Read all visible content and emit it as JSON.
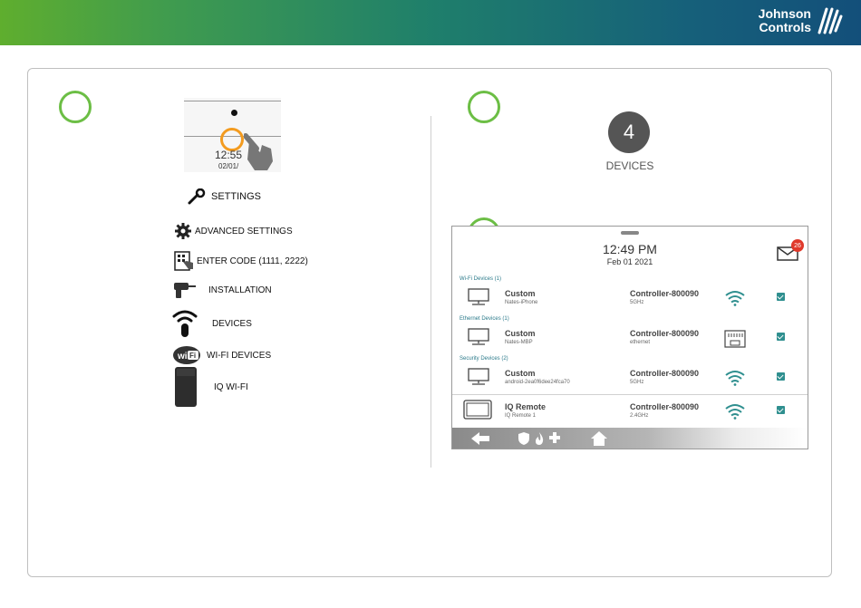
{
  "brand": {
    "line1": "Johnson",
    "line2": "Controls",
    "color": "#ffffff"
  },
  "colors": {
    "accent_green": "#6cbe45",
    "orange_ring": "#f39b1f",
    "teal": "#2f8f8f",
    "badge_red": "#e0392b"
  },
  "left": {
    "phone": {
      "time": "12:55",
      "date": "02/01/"
    },
    "settings_label": "SETTINGS",
    "menu": [
      {
        "icon": "gear-icon",
        "label": "ADVANCED SETTINGS"
      },
      {
        "icon": "keypad-hand-icon",
        "label": "ENTER CODE (1111, 2222)"
      },
      {
        "icon": "drill-icon",
        "label": "INSTALLATION"
      },
      {
        "icon": "remote-wifi-icon",
        "label": "DEVICES"
      },
      {
        "icon": "wifi-badge-icon",
        "label": "WI-FI DEVICES"
      },
      {
        "icon": "router-icon",
        "label": "IQ WI-FI"
      }
    ]
  },
  "right": {
    "devices_count": "4",
    "devices_label": "DEVICES",
    "tablet": {
      "time": "12:49 PM",
      "date": "Feb 01 2021",
      "mail_count": "26",
      "sections": [
        {
          "title": "Wi-Fi Devices (1)"
        },
        {
          "title": "Ethernet Devices (1)"
        },
        {
          "title": "Security Devices (2)"
        }
      ],
      "rows": [
        {
          "name": "Custom",
          "sub": "Nates-iPhone",
          "controller": "Controller-800090",
          "band": "5GHz",
          "icon": "wifi-signal-icon",
          "checked": true
        },
        {
          "name": "Custom",
          "sub": "Nates-MBP",
          "controller": "Controller-800090",
          "band": "ethernet",
          "icon": "ethernet-port-icon",
          "checked": true
        },
        {
          "name": "Custom",
          "sub": "android-2ea0f6dee24fca70",
          "controller": "Controller-800090",
          "band": "5GHz",
          "icon": "wifi-signal-icon",
          "checked": true
        },
        {
          "name": "IQ Remote",
          "sub": "IQ Remote 1",
          "controller": "Controller-800090",
          "band": "2.4GHz",
          "icon": "wifi-signal-icon",
          "checked": true
        }
      ]
    }
  }
}
